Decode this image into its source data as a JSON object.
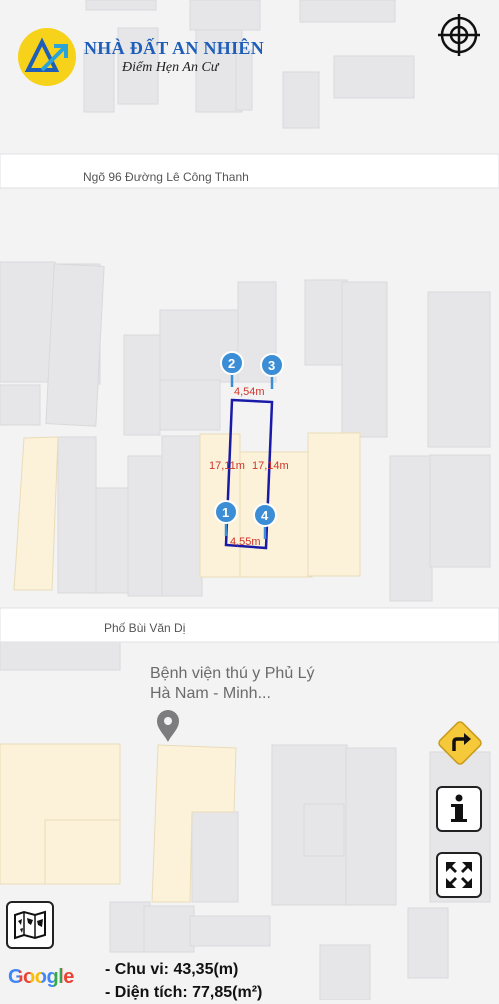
{
  "brand": {
    "name": "NHÀ ĐẤT AN NHIÊN",
    "slogan": "Điểm Hẹn An Cư",
    "colors": {
      "logo_circle": "#f7d21a",
      "logo_text": "#1f5eb8"
    }
  },
  "map": {
    "streets": {
      "north": "Ngõ 96 Đường Lê Công Thanh",
      "south": "Phố Bùi Văn Dị"
    },
    "poi": {
      "name": "Bệnh viện thú y Phủ Lý Hà Nam - Minh...",
      "icon": "map-pin-icon"
    },
    "parcel": {
      "outline_color": "#1a1aa8",
      "markers": [
        "1",
        "2",
        "3",
        "4"
      ],
      "marker_color": "#3b8ed6",
      "edge_labels": {
        "top": "4,54m",
        "left": "17,11m",
        "right": "17,14m",
        "bottom": "4,55m"
      },
      "label_color": "#d0352a"
    }
  },
  "controls": {
    "location": "crosshair-icon",
    "directions": "turn-right-icon",
    "info": "info-icon",
    "fullscreen": "expand-icon",
    "map_layers": "folded-map-icon"
  },
  "attribution": "Google",
  "summary": {
    "perimeter": "- Chu vi: 43,35(m)",
    "area": "- Diện tích: 77,85(m²)"
  }
}
